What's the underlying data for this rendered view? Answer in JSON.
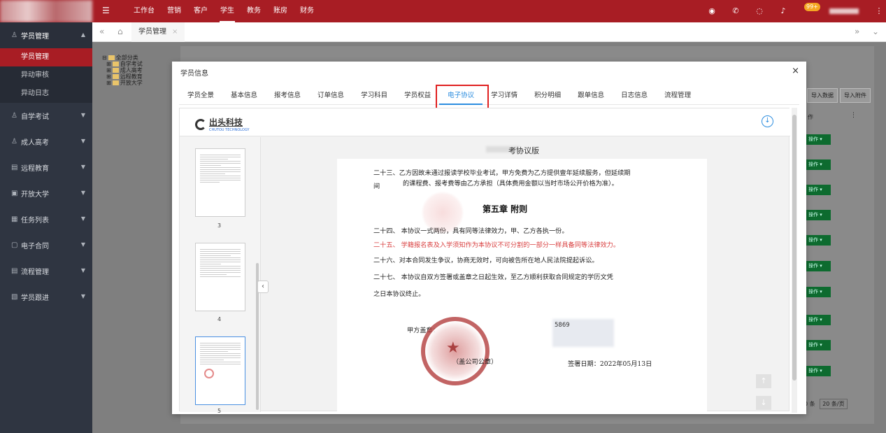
{
  "topbar": {
    "nav": [
      "工作台",
      "营销",
      "客户",
      "学生",
      "教务",
      "账房",
      "财务"
    ],
    "active_nav": "学生",
    "badge": "99+"
  },
  "sidebar": {
    "open_group": "学员管理",
    "sub_items": [
      "学员管理",
      "异动审核",
      "异动日志"
    ],
    "active_sub": "学员管理",
    "groups": [
      {
        "label": "自学考试",
        "icon": "person-icon"
      },
      {
        "label": "成人高考",
        "icon": "person-icon"
      },
      {
        "label": "远程教育",
        "icon": "list-icon"
      },
      {
        "label": "开放大学",
        "icon": "id-card-icon"
      },
      {
        "label": "任务列表",
        "icon": "task-icon"
      },
      {
        "label": "电子合同",
        "icon": "contract-icon"
      },
      {
        "label": "流程管理",
        "icon": "list-icon"
      },
      {
        "label": "学员跟进",
        "icon": "doc-icon"
      }
    ]
  },
  "tabsbar": {
    "tab": "学员管理",
    "close": "×",
    "more": "»"
  },
  "tree": {
    "root": "全部分类",
    "children": [
      "自学考试",
      "成人高考",
      "远程教育",
      "开放大学"
    ]
  },
  "background": {
    "import_data": "导入数据",
    "import_attach": "导入附件",
    "op_header": "作",
    "op_btn": "操作 ▾",
    "pager_count": "0 条",
    "pager_size": "20 条/页"
  },
  "modal": {
    "title": "学员信息",
    "close": "×",
    "tabs": [
      "学员全景",
      "基本信息",
      "报考信息",
      "订单信息",
      "学习科目",
      "学员权益",
      "电子协议",
      "学习详情",
      "积分明细",
      "跟单信息",
      "日志信息",
      "流程管理"
    ],
    "active_tab": "电子协议"
  },
  "viewer": {
    "logo_text": "出头科技",
    "logo_sub": "CHUTOU TECHNOLOGY",
    "doc_title": "考协议版",
    "thumb_numbers": [
      "3",
      "4",
      "5"
    ],
    "page": {
      "line23a": "二十三、乙方因故未通过报读学校毕业考试，甲方免费为乙方提供壹年延续服务，但延续期",
      "line23b_prefix": "间",
      "line23b": "的课程费、报考费等由乙方承担（具体费用金额以当时市场公开价格为准）。",
      "chapter": "第五章 附则",
      "line24": "二十四、 本协议一式两份，具有同等法律效力，甲、乙方各执一份。",
      "line25": "二十五、 学籍报名表及入学须知作为本协议不可分割的一部分一样具备同等法律效力。",
      "line26": "二十六、对本合同发生争议，协商无效时，可向被告所在地人民法院提起诉讼。",
      "line27a": "二十七、 本协议自双方签署或盖章之日起生效，至乙方顺利获取合同规定的学历文凭",
      "line27b": "之日本协议终止。",
      "party_a": "甲方盖章：",
      "seal_note": "（盖公司公章）",
      "sig_number": "5869",
      "sign_date": "签署日期：2022年05月13日"
    }
  },
  "colors": {
    "brand": "#a81d24",
    "active_tab": "#2c8ddf",
    "highlight": "#e02020",
    "red_text": "#d94040"
  }
}
